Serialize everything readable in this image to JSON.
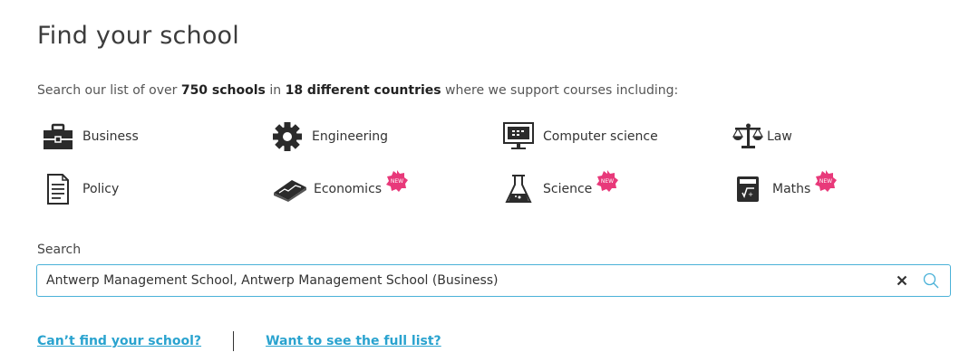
{
  "heading": "Find your school",
  "intro": {
    "prefix": "Search our list of over ",
    "schools": "750 schools",
    "middle": " in ",
    "countries": "18 different countries",
    "suffix": " where we support courses including:"
  },
  "subjects": [
    {
      "label": "Business",
      "icon": "briefcase-icon",
      "is_new": false
    },
    {
      "label": "Engineering",
      "icon": "gear-icon",
      "is_new": false
    },
    {
      "label": "Computer science",
      "icon": "computer-monitor-icon",
      "is_new": false
    },
    {
      "label": "Law",
      "icon": "scales-icon",
      "is_new": false
    },
    {
      "label": "Policy",
      "icon": "document-icon",
      "is_new": false
    },
    {
      "label": "Economics",
      "icon": "book-chart-icon",
      "is_new": true
    },
    {
      "label": "Science",
      "icon": "flask-icon",
      "is_new": true
    },
    {
      "label": "Maths",
      "icon": "calculator-icon",
      "is_new": true
    }
  ],
  "new_badge": {
    "text": "NEW",
    "color": "#e8397a"
  },
  "search": {
    "label": "Search",
    "value": "Antwerp Management School, Antwerp Management School (Business)",
    "border_color": "#4bb2d8"
  },
  "links": {
    "cant_find": "Can’t find your school?",
    "full_list": "Want to see the full list?",
    "color": "#2aa3cf"
  }
}
